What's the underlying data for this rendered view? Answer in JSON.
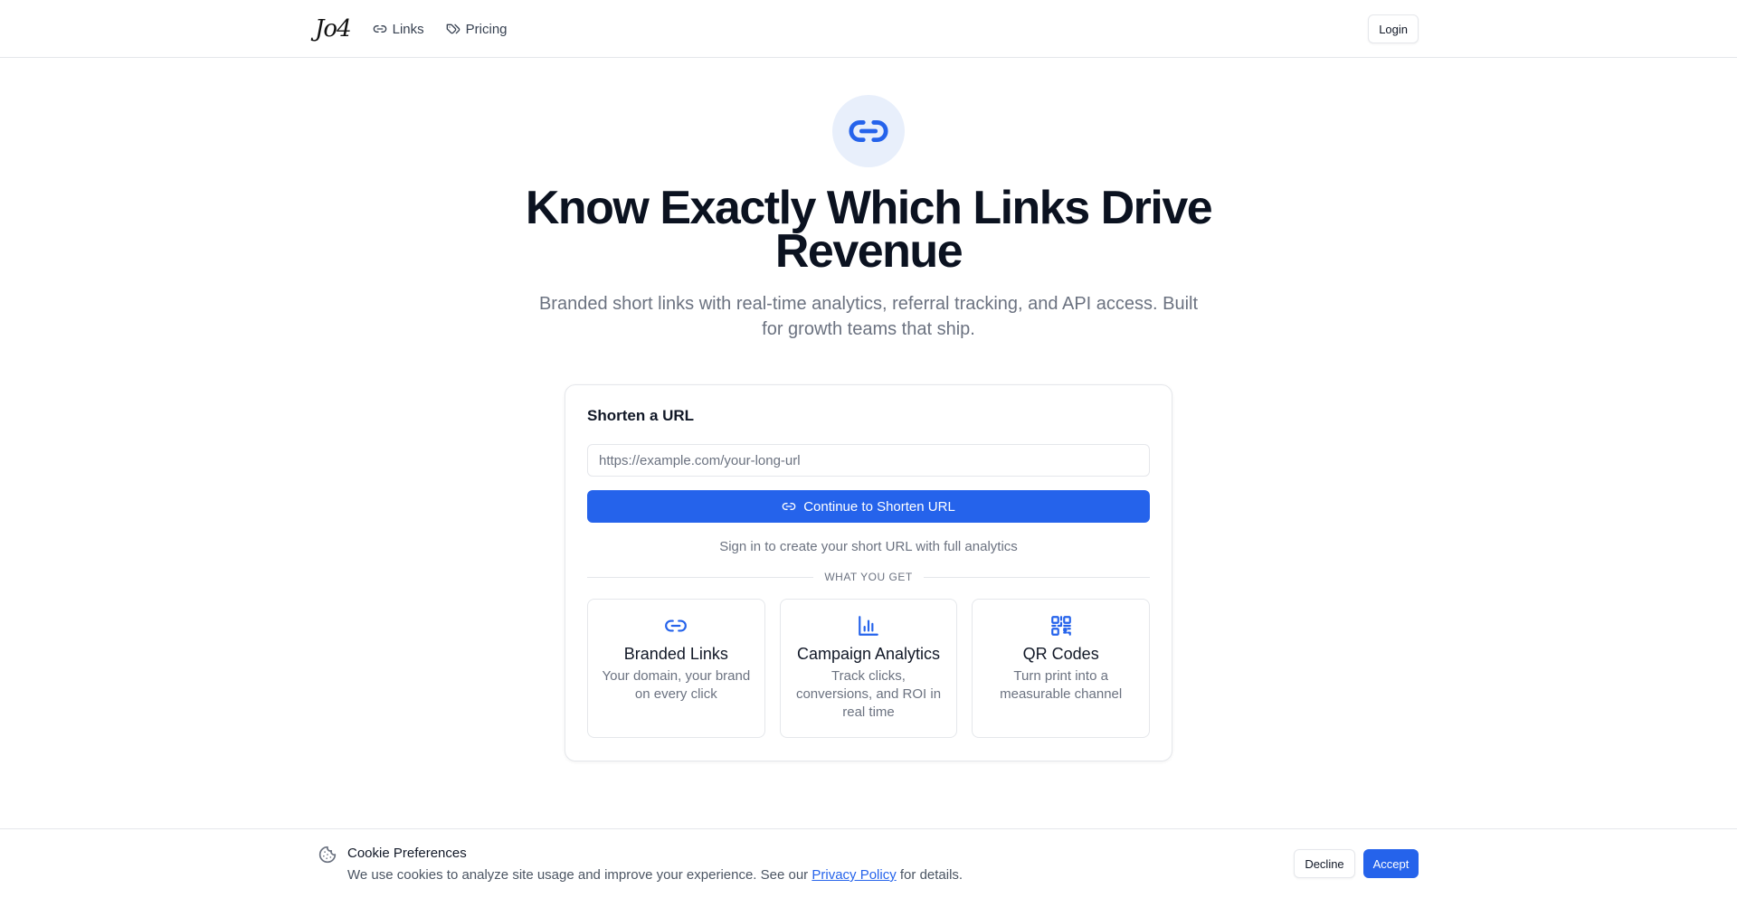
{
  "header": {
    "logo": "Jo4",
    "nav": [
      {
        "label": "Links",
        "icon": "link-icon"
      },
      {
        "label": "Pricing",
        "icon": "tags-icon"
      }
    ],
    "login_label": "Login"
  },
  "hero": {
    "icon": "link-icon",
    "title": "Know Exactly Which Links Drive Revenue",
    "subtitle": "Branded short links with real-time analytics, referral tracking, and API access. Built for growth teams that ship."
  },
  "card": {
    "title": "Shorten a URL",
    "input": {
      "placeholder": "https://example.com/your-long-url",
      "value": ""
    },
    "button_label": "Continue to Shorten URL",
    "note": "Sign in to create your short URL with full analytics",
    "divider_label": "WHAT YOU GET",
    "features": [
      {
        "icon": "link-icon",
        "title": "Branded Links",
        "desc": "Your domain, your brand on every click"
      },
      {
        "icon": "bar-chart-icon",
        "title": "Campaign Analytics",
        "desc": "Track clicks, conversions, and ROI in real time"
      },
      {
        "icon": "qr-code-icon",
        "title": "QR Codes",
        "desc": "Turn print into a measurable channel"
      }
    ]
  },
  "cookie": {
    "icon": "cookie-icon",
    "title": "Cookie Preferences",
    "text_before": "We use cookies to analyze site usage and improve your experience. See our",
    "link_label": "Privacy Policy",
    "text_after": "for details.",
    "decline_label": "Decline",
    "accept_label": "Accept"
  },
  "colors": {
    "accent": "#2563eb",
    "icon_bg": "#e8effb"
  }
}
